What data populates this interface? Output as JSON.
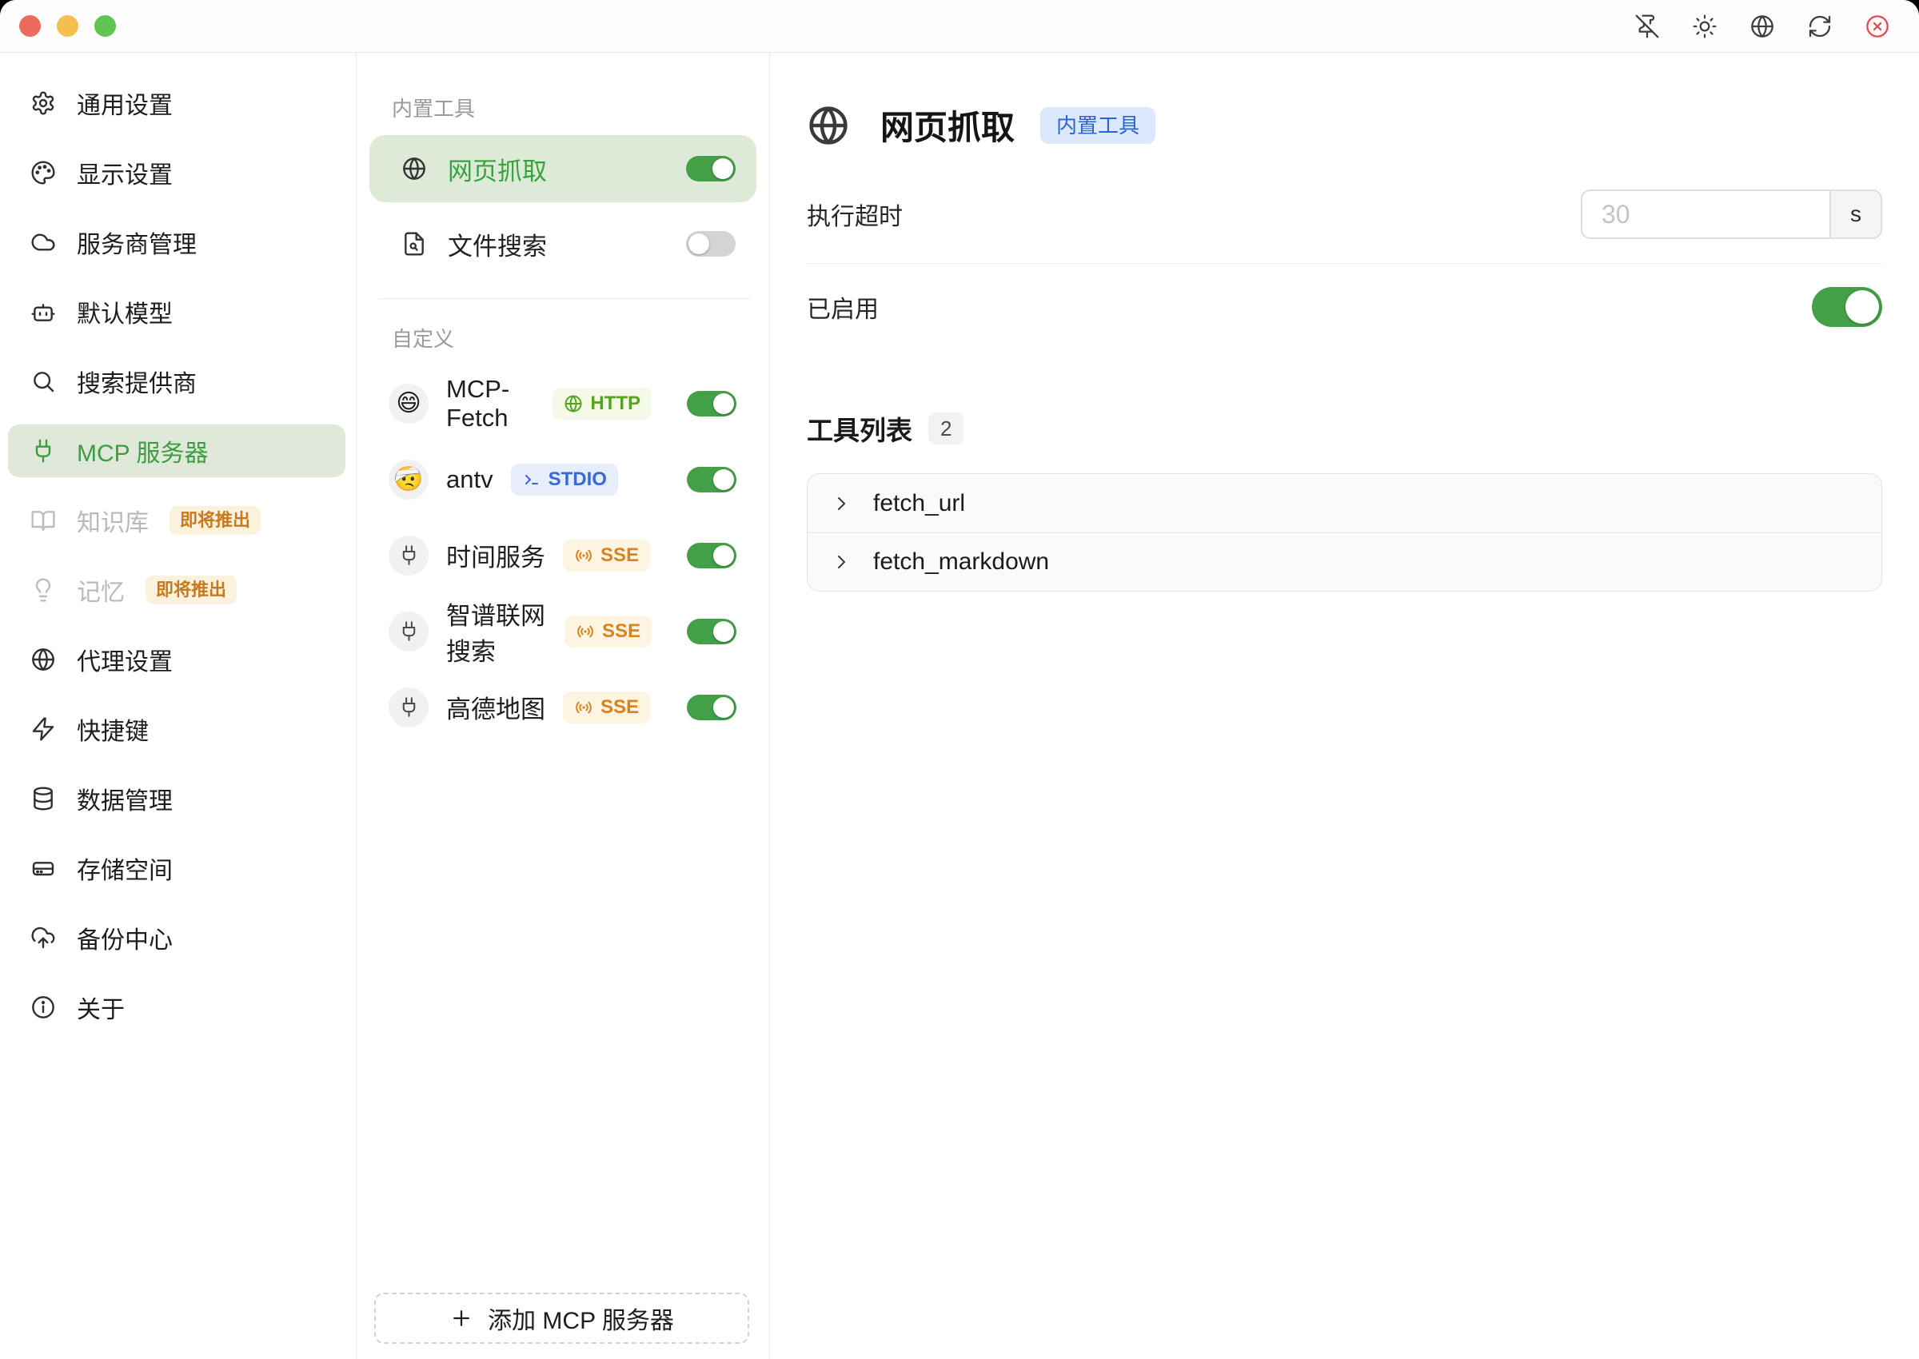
{
  "window": {
    "traffic_lights": [
      {
        "name": "close",
        "color": "#ed6a5e"
      },
      {
        "name": "minimize",
        "color": "#f5bf4f"
      },
      {
        "name": "zoom",
        "color": "#61c554"
      }
    ],
    "titlebar_actions": [
      {
        "icon": "pin-off"
      },
      {
        "icon": "sun"
      },
      {
        "icon": "globe"
      },
      {
        "icon": "refresh"
      },
      {
        "icon": "close-circle",
        "danger": true
      }
    ]
  },
  "sidebar": {
    "items": [
      {
        "label": "通用设置",
        "icon": "gear"
      },
      {
        "label": "显示设置",
        "icon": "palette"
      },
      {
        "label": "服务商管理",
        "icon": "cloud"
      },
      {
        "label": "默认模型",
        "icon": "bot"
      },
      {
        "label": "搜索提供商",
        "icon": "search"
      },
      {
        "label": "MCP 服务器",
        "icon": "plug",
        "selected": true
      },
      {
        "label": "知识库",
        "icon": "book",
        "disabled": true,
        "badge": "即将推出"
      },
      {
        "label": "记忆",
        "icon": "bulb",
        "disabled": true,
        "badge": "即将推出"
      },
      {
        "label": "代理设置",
        "icon": "globe"
      },
      {
        "label": "快捷键",
        "icon": "zap"
      },
      {
        "label": "数据管理",
        "icon": "database"
      },
      {
        "label": "存储空间",
        "icon": "drive"
      },
      {
        "label": "备份中心",
        "icon": "cloud-upload"
      },
      {
        "label": "关于",
        "icon": "info"
      }
    ]
  },
  "server_list": {
    "builtin_header": "内置工具",
    "custom_header": "自定义",
    "builtin_items": [
      {
        "name": "网页抓取",
        "icon": "globe",
        "enabled": true,
        "selected": true
      },
      {
        "name": "文件搜索",
        "icon": "file-search",
        "enabled": false,
        "selected": false
      }
    ],
    "custom_items": [
      {
        "name": "MCP-Fetch",
        "avatar_emoji": "😄",
        "transport": "HTTP",
        "enabled": true
      },
      {
        "name": "antv",
        "avatar_emoji": "🤕",
        "transport": "STDIO",
        "enabled": true
      },
      {
        "name": "时间服务",
        "avatar_icon": "plug",
        "transport": "SSE",
        "enabled": true
      },
      {
        "name": "智谱联网搜索",
        "avatar_icon": "plug",
        "transport": "SSE",
        "enabled": true
      },
      {
        "name": "高德地图",
        "avatar_icon": "plug",
        "transport": "SSE",
        "enabled": true
      }
    ],
    "add_button_label": "添加 MCP 服务器"
  },
  "detail": {
    "title": "网页抓取",
    "type_badge": "内置工具",
    "timeout_label": "执行超时",
    "timeout_placeholder": "30",
    "timeout_unit": "s",
    "enabled_label": "已启用",
    "enabled": true,
    "tools_header": "工具列表",
    "tools_count": "2",
    "tools": [
      "fetch_url",
      "fetch_markdown"
    ]
  },
  "colors": {
    "accent_green": "#43a047",
    "sidebar_selected_bg": "#dfe8d9",
    "sidebar_selected_fg": "#3d9e41",
    "server_selected_bg": "#dcead7",
    "server_selected_fg": "#3aa23d",
    "badge_http_fg": "#55a41f",
    "badge_http_bg": "#f5fae8",
    "badge_stdio_fg": "#3b68d8",
    "badge_stdio_bg": "#e6eefb",
    "badge_sse_fg": "#d9831f",
    "badge_sse_bg": "#fdf4e2",
    "badge_soon_fg": "#c8791b",
    "badge_soon_bg": "#fbf2de",
    "badge_builtin_fg": "#2b63d9",
    "badge_builtin_bg": "#dce8fb"
  }
}
